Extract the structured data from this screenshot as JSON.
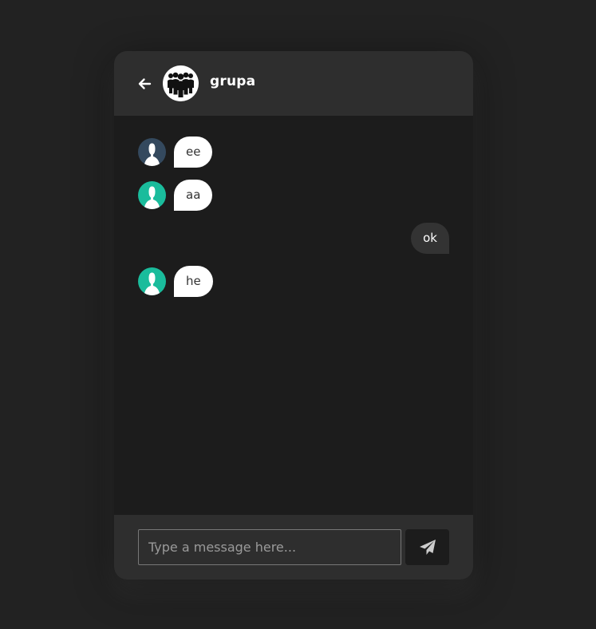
{
  "header": {
    "title": "grupa",
    "back_icon": "arrow-left-icon",
    "avatar_icon": "group-people-icon"
  },
  "messages": [
    {
      "direction": "incoming",
      "text": "ee",
      "avatar_color": "#34495e"
    },
    {
      "direction": "incoming",
      "text": "aa",
      "avatar_color": "#1abc9c"
    },
    {
      "direction": "outgoing",
      "text": "ok"
    },
    {
      "direction": "incoming",
      "text": "he",
      "avatar_color": "#1abc9c"
    }
  ],
  "composer": {
    "placeholder": "Type a message here...",
    "value": "",
    "send_icon": "paper-plane-icon"
  },
  "colors": {
    "page_bg": "#222222",
    "panel_bg": "#1c1c1c",
    "bar_bg": "#2e2e2e",
    "incoming_bubble": "#ffffff",
    "outgoing_bubble": "#333333"
  }
}
